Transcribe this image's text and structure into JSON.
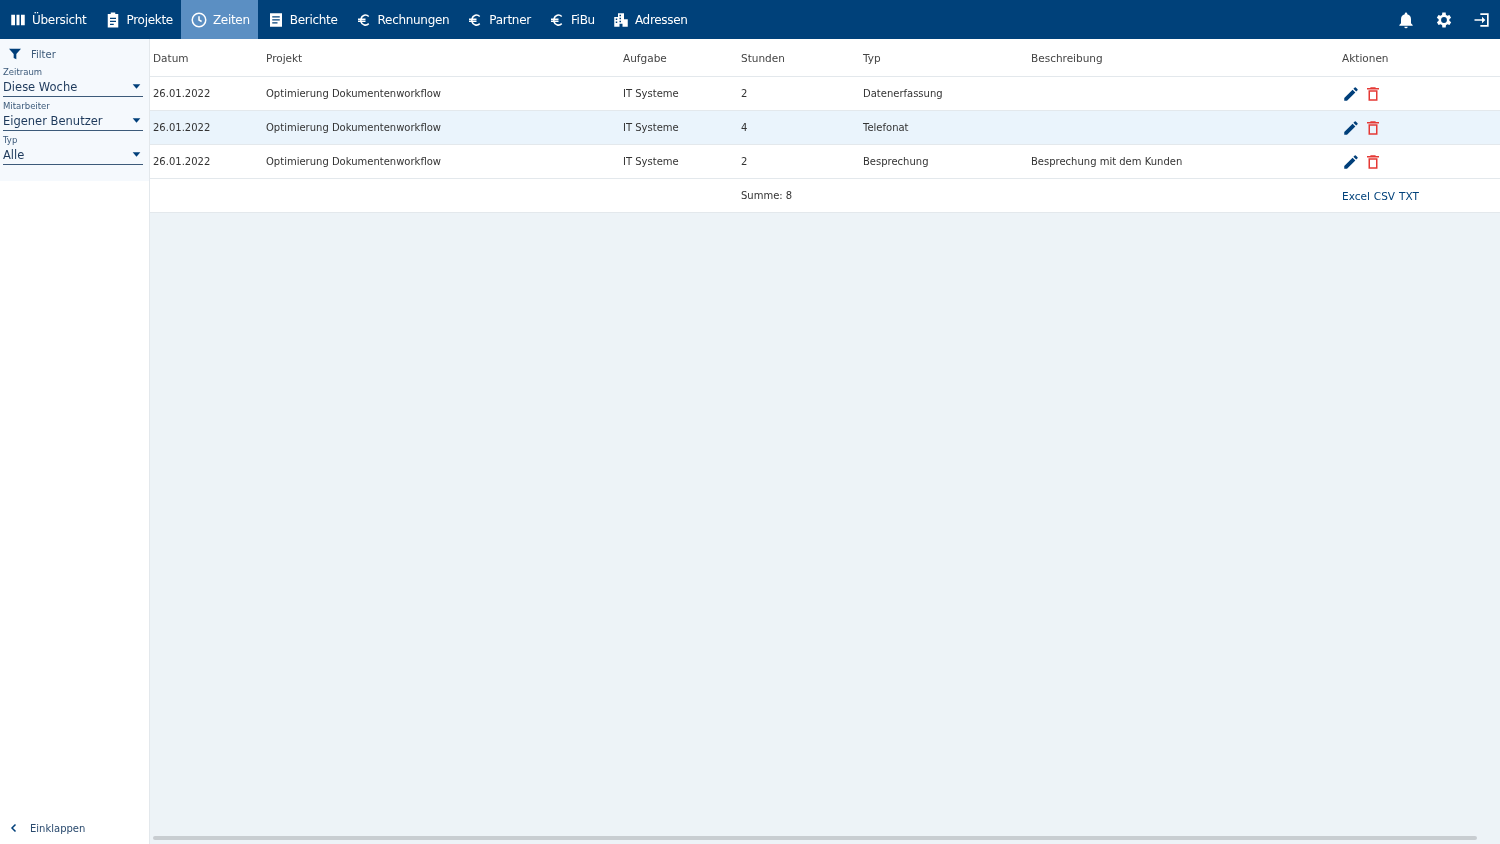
{
  "nav": {
    "items": [
      {
        "label": "Übersicht",
        "selected": false
      },
      {
        "label": "Projekte",
        "selected": false
      },
      {
        "label": "Zeiten",
        "selected": true
      },
      {
        "label": "Berichte",
        "selected": false
      },
      {
        "label": "Rechnungen",
        "selected": false
      },
      {
        "label": "Partner",
        "selected": false
      },
      {
        "label": "FiBu",
        "selected": false
      },
      {
        "label": "Adressen",
        "selected": false
      }
    ]
  },
  "sidebar": {
    "title": "Filter",
    "filters": [
      {
        "label": "Zeitraum",
        "value": "Diese Woche"
      },
      {
        "label": "Mitarbeiter",
        "value": "Eigener Benutzer"
      },
      {
        "label": "Typ",
        "value": "Alle"
      }
    ],
    "collapse": "Einklappen"
  },
  "table": {
    "columns": [
      "Datum",
      "Projekt",
      "Aufgabe",
      "Stunden",
      "Typ",
      "Beschreibung",
      "Aktionen"
    ],
    "rows": [
      {
        "cells": [
          "26.01.2022",
          "Optimierung Dokumentenworkflow",
          "IT Systeme",
          "2",
          "Datenerfassung",
          ""
        ],
        "selected": false
      },
      {
        "cells": [
          "26.01.2022",
          "Optimierung Dokumentenworkflow",
          "IT Systeme",
          "4",
          "Telefonat",
          ""
        ],
        "selected": true
      },
      {
        "cells": [
          "26.01.2022",
          "Optimierung Dokumentenworkflow",
          "IT Systeme",
          "2",
          "Besprechung",
          "Besprechung mit dem Kunden"
        ],
        "selected": false
      }
    ],
    "sum": "Summe: 8",
    "exports": [
      "Excel",
      "CSV",
      "TXT"
    ]
  }
}
